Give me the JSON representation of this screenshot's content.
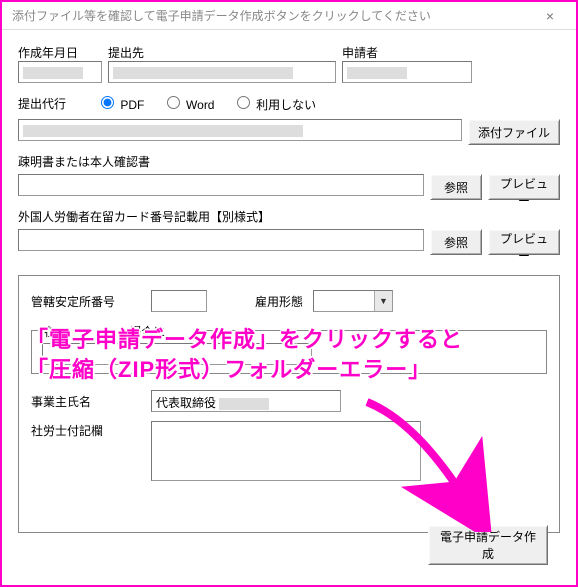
{
  "window": {
    "title": "添付ファイル等を確認して電子申請データ作成ボタンをクリックしてください",
    "close_icon": "×"
  },
  "headers": {
    "creation_date": "作成年月日",
    "destination": "提出先",
    "applicant": "申請者"
  },
  "proxy": {
    "label": "提出代行",
    "radios": {
      "pdf": "PDF",
      "word": "Word",
      "none": "利用しない"
    },
    "attach_button": "添付ファイル"
  },
  "file1": {
    "label": "疎明書または本人確認書",
    "browse": "参照",
    "preview": "プレビュー"
  },
  "file2": {
    "label": "外国人労働者在留カード番号記載用【別様式】",
    "browse": "参照",
    "preview": "プレビュー"
  },
  "group": {
    "left_label": "管轄安定所番号",
    "right_label": "雇用形態",
    "legend_visible_prefix": "在",
    "legend_visible_suffix": "場合に",
    "owner_label": "事業主氏名",
    "owner_value_prefix": "代表取締役",
    "memo_label": "社労士付記欄"
  },
  "create_button": "電子申請データ作成",
  "annotation": {
    "line1": "「電子申請データ作成」をクリックすると",
    "line2": "「圧縮（ZIP形式）フォルダーエラー」"
  }
}
